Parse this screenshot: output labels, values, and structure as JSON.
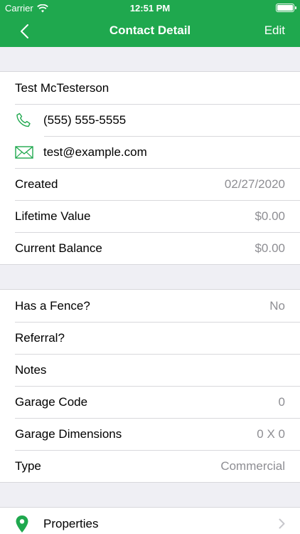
{
  "status_bar": {
    "carrier": "Carrier",
    "time": "12:51 PM",
    "battery_level": 1.0
  },
  "nav": {
    "title": "Contact Detail",
    "edit_label": "Edit",
    "back_icon": "chevron-left-icon"
  },
  "contact": {
    "name": "Test McTesterson",
    "phone": "(555) 555-5555",
    "email": "test@example.com",
    "created_label": "Created",
    "created_value": "02/27/2020",
    "lifetime_label": "Lifetime Value",
    "lifetime_value": "$0.00",
    "balance_label": "Current Balance",
    "balance_value": "$0.00"
  },
  "fields": {
    "fence_label": "Has a Fence?",
    "fence_value": "No",
    "referral_label": "Referral?",
    "notes_label": "Notes",
    "garage_code_label": "Garage Code",
    "garage_code_value": "0",
    "garage_dim_label": "Garage Dimensions",
    "garage_dim_value": "0 X 0",
    "type_label": "Type",
    "type_value": "Commercial"
  },
  "properties": {
    "label": "Properties"
  },
  "colors": {
    "accent": "#1fa84e",
    "background": "#efeff4",
    "secondary_text": "#8e8e93"
  }
}
